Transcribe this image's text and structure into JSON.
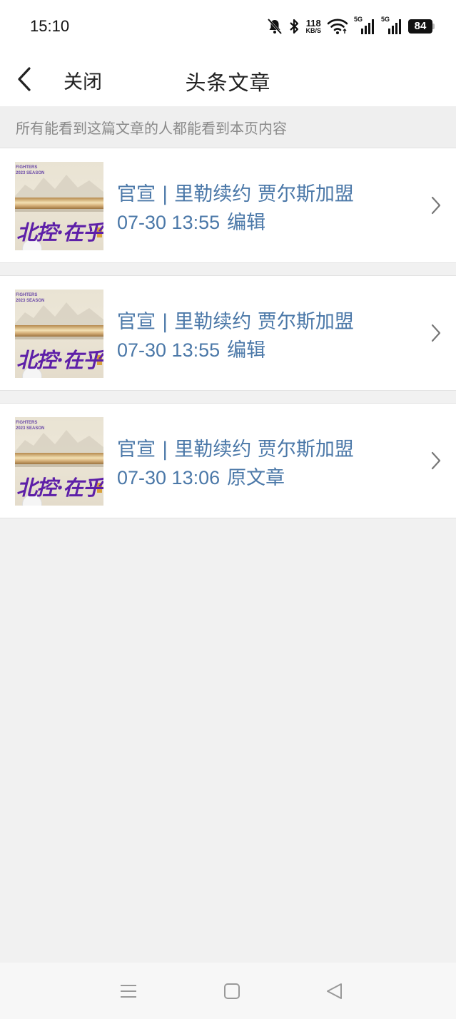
{
  "status_bar": {
    "time": "15:10",
    "net_speed_value": "118",
    "net_speed_unit": "KB/S",
    "signal1_label": "5G",
    "signal2_label": "5G",
    "battery": "84"
  },
  "header": {
    "close_label": "关闭",
    "title": "头条文章"
  },
  "notice": "所有能看到这篇文章的人都能看到本页内容",
  "articles": [
    {
      "title": "官宣 | 里勒续约 贾尔斯加盟",
      "time": "07-30 13:55",
      "tag": "编辑",
      "thumb_brand": "北控·在乎",
      "thumb_small": [
        "FIGHTERS",
        "2023 SEASON"
      ]
    },
    {
      "title": "官宣 | 里勒续约 贾尔斯加盟",
      "time": "07-30 13:55",
      "tag": "编辑",
      "thumb_brand": "北控·在乎",
      "thumb_small": [
        "FIGHTERS",
        "2023 SEASON"
      ]
    },
    {
      "title": "官宣 | 里勒续约 贾尔斯加盟",
      "time": "07-30 13:06",
      "tag": "原文章",
      "thumb_brand": "北控·在乎",
      "thumb_small": [
        "FIGHTERS",
        "2023 SEASON"
      ]
    }
  ],
  "icons": {
    "back": "chevron-left-icon",
    "item_arrow": "chevron-right-icon",
    "nav_menu": "menu-icon",
    "nav_home": "square-home-icon",
    "nav_back": "triangle-back-icon"
  },
  "colors": {
    "link": "#4b78a8",
    "notice_text": "#8a8a8a",
    "background": "#f1f1f1",
    "thumb_brand": "#5d1fa8"
  }
}
